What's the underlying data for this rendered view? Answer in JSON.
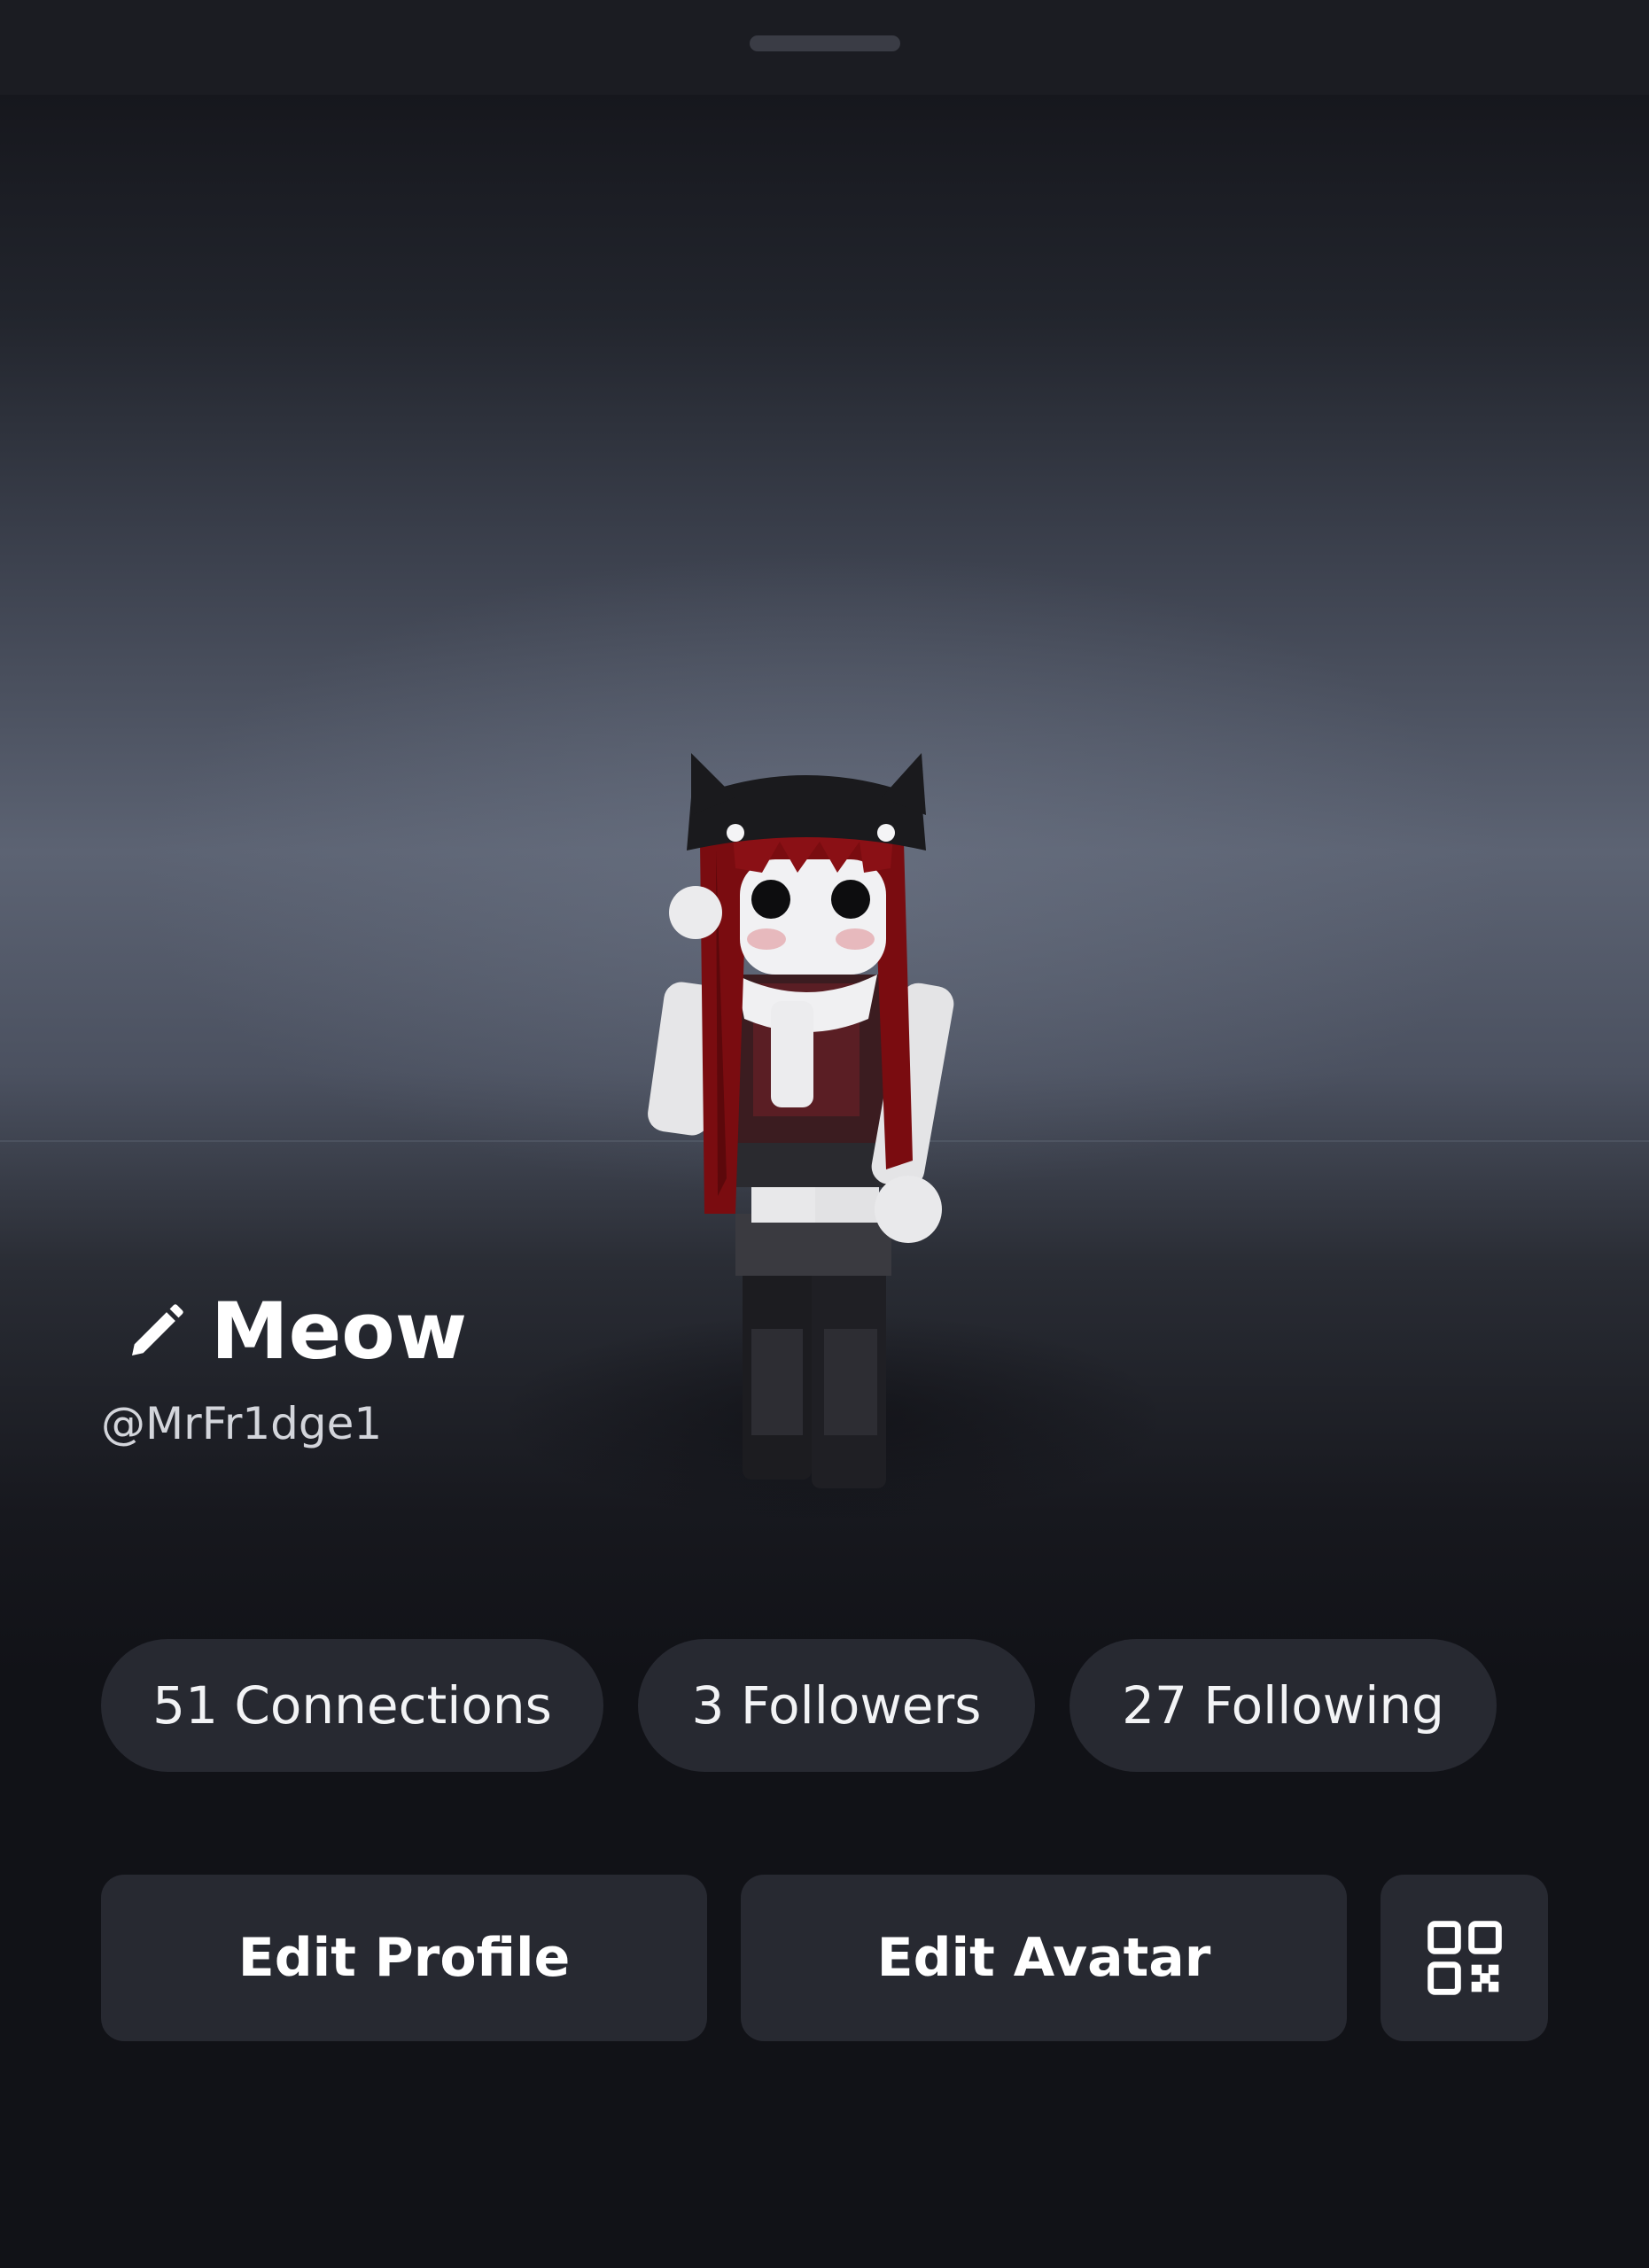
{
  "profile": {
    "display_name": "Meow",
    "username": "@MrFr1dge1"
  },
  "stats": {
    "connections": "51 Connections",
    "followers": "3 Followers",
    "following": "27 Following"
  },
  "actions": {
    "edit_profile": "Edit Profile",
    "edit_avatar": "Edit Avatar"
  },
  "icons": {
    "edit_name": "pencil-icon",
    "qr": "qr-code-icon"
  },
  "colors": {
    "background": "#111217",
    "button": "#272931",
    "text": "#ffffff",
    "muted_text": "#d3d5db"
  }
}
